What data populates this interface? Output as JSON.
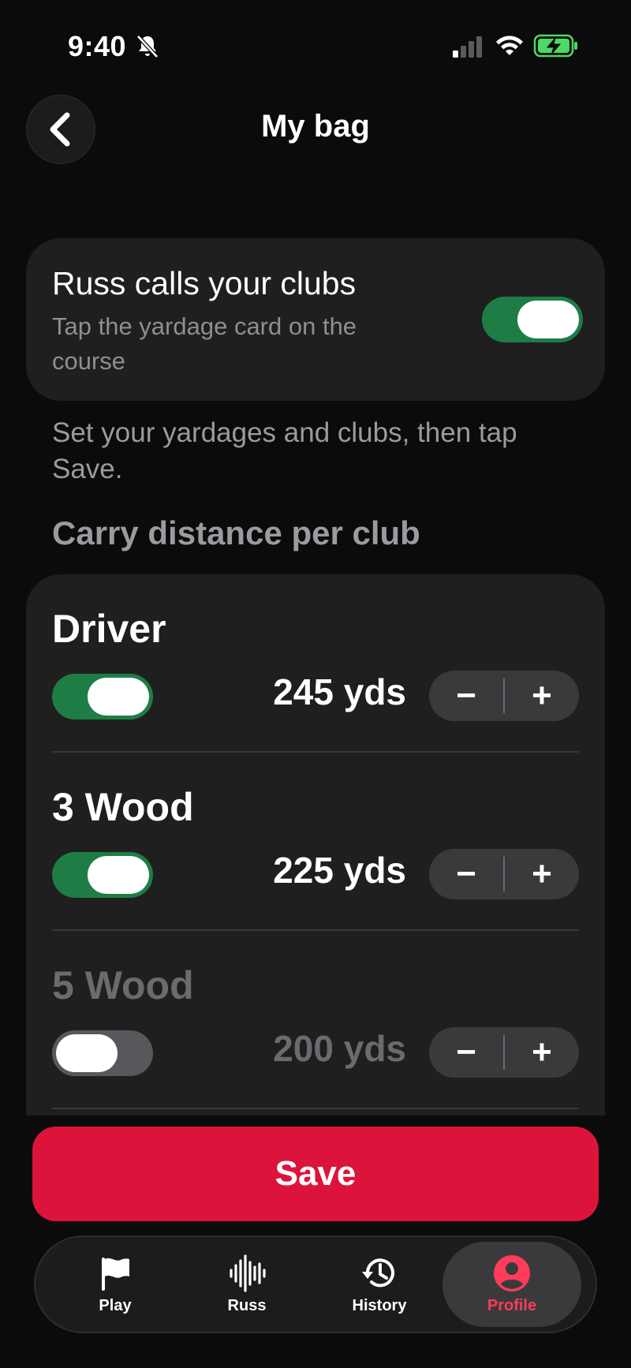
{
  "status_bar": {
    "time": "9:40"
  },
  "header": {
    "title": "My bag"
  },
  "russ_card": {
    "title": "Russ calls your clubs",
    "subtitle": "Tap the yardage card on the course",
    "enabled": true
  },
  "helper_text": "Set your yardages and clubs, then tap Save.",
  "section_title": "Carry distance per club",
  "clubs": [
    {
      "name": "Driver",
      "distance": "245 yds",
      "enabled": true
    },
    {
      "name": "3 Wood",
      "distance": "225 yds",
      "enabled": true
    },
    {
      "name": "5 Wood",
      "distance": "200 yds",
      "enabled": false
    }
  ],
  "stepper": {
    "minus": "−",
    "plus": "+"
  },
  "save_label": "Save",
  "tabs": [
    {
      "label": "Play",
      "icon": "flag-icon"
    },
    {
      "label": "Russ",
      "icon": "waveform-icon"
    },
    {
      "label": "History",
      "icon": "history-icon"
    },
    {
      "label": "Profile",
      "icon": "profile-icon",
      "active": true
    }
  ],
  "colors": {
    "accent": "#dc143c",
    "toggle_on": "#1e7d45",
    "active_tab": "#ff3b5c"
  }
}
